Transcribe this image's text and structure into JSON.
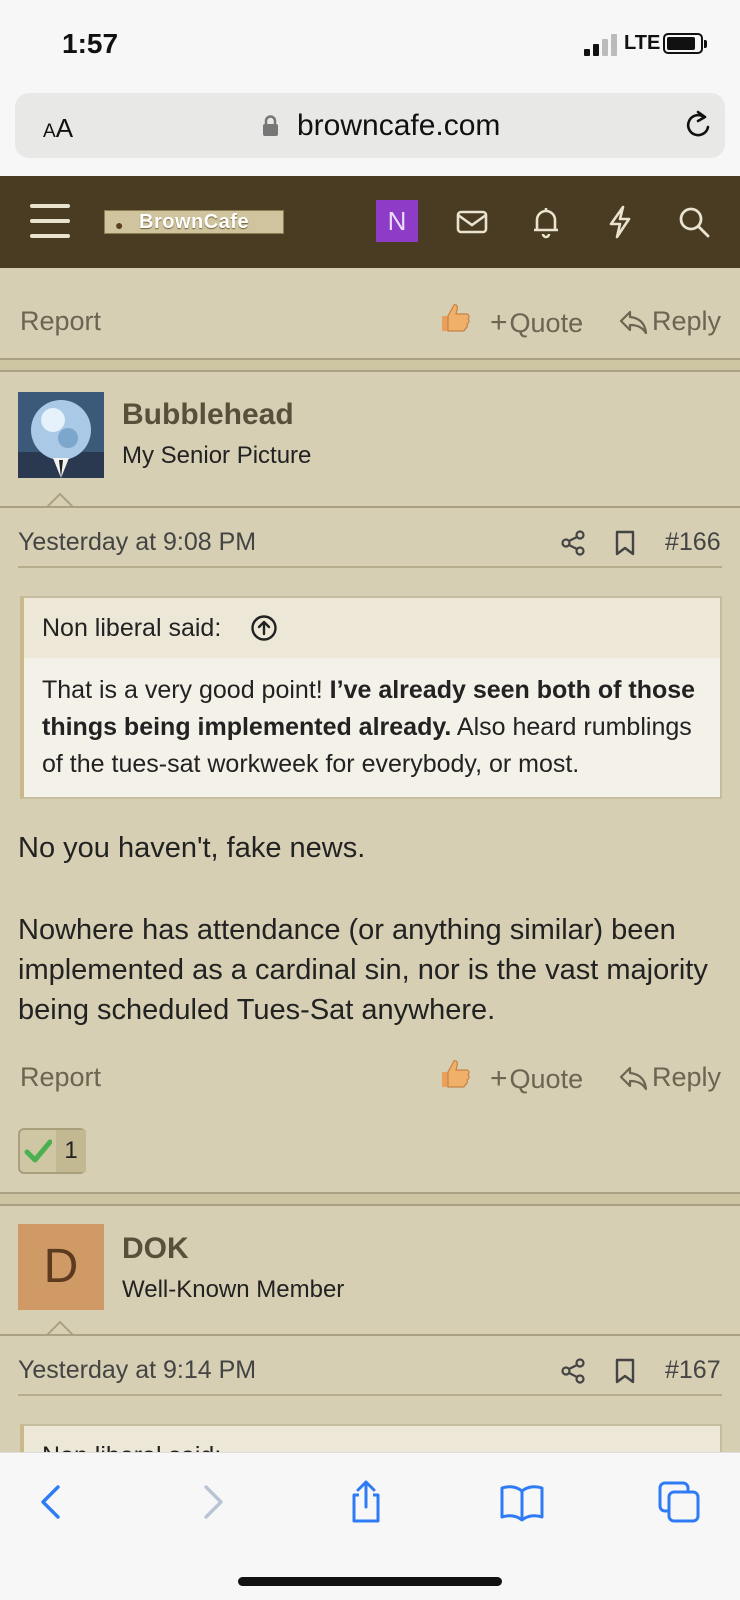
{
  "status_bar": {
    "time": "1:57",
    "network": "LTE"
  },
  "browser": {
    "text_size_label_small": "A",
    "text_size_label_large": "A",
    "url": "browncafe.com"
  },
  "site_nav": {
    "logo_text": "BrownCafe",
    "user_initial": "N"
  },
  "actions": {
    "report": "Report",
    "quote": "Quote",
    "quote_plus": "+",
    "reply": "Reply"
  },
  "posts": [
    {
      "username": "Bubblehead",
      "user_title": "My Senior Picture",
      "date": "Yesterday at 9:08 PM",
      "number": "#166",
      "quote_author": "Non liberal said:",
      "quote_part1": "That is a very good point! ",
      "quote_bold": "I’ve already seen both of those things being implemented already.",
      "quote_part2": " Also heard rumblings of the tues-sat workweek for everybody, or most.",
      "message_line1": "No you haven't, fake news.",
      "message_line2": "Nowhere has attendance (or anything similar) been implemented as a cardinal sin, nor is the vast majority being scheduled Tues-Sat anywhere.",
      "reaction_count": "1"
    },
    {
      "username": "DOK",
      "avatar_letter": "D",
      "user_title": "Well-Known Member",
      "date": "Yesterday at 9:14 PM",
      "number": "#167",
      "quote_author": "Non liberal said:"
    }
  ],
  "colors": {
    "page_bg": "#d6cfb3",
    "nav_bg": "#4a3c22",
    "accent_purple": "#8e3bc8",
    "ios_blue": "#2f7bf5",
    "dok_avatar": "#cf9a66"
  },
  "icons": [
    "menu-icon",
    "mail-icon",
    "bell-icon",
    "lightning-icon",
    "search-icon",
    "like-icon",
    "reply-icon",
    "share-icon",
    "bookmark-icon",
    "check-icon",
    "back-icon",
    "forward-icon",
    "share-sheet-icon",
    "bookmarks-book-icon",
    "tabs-icon",
    "lock-icon",
    "reload-icon"
  ]
}
